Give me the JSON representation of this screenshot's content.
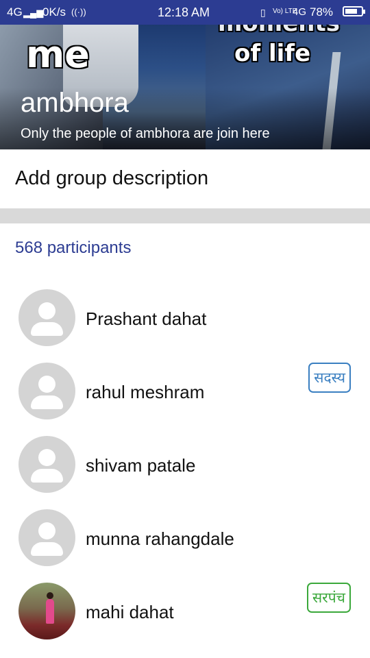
{
  "status_bar": {
    "network_left": "4G",
    "speed": "0K/s",
    "time": "12:18 AM",
    "network_right": "4G",
    "volte": "Vo) LTE",
    "battery": "78%",
    "battery_level": 0.78
  },
  "header": {
    "meme_top_right": "moments",
    "meme_left": "me",
    "meme_right": "of life",
    "group_name": "ambhora",
    "group_tagline": "Only the people of ambhora are join here"
  },
  "description": {
    "placeholder": "Add group description"
  },
  "participants": {
    "count_label": "568 participants",
    "items": [
      {
        "name": "Prashant dahat",
        "badge": "",
        "badge_color": "",
        "avatar": "default"
      },
      {
        "name": "rahul meshram",
        "badge": "सदस्य",
        "badge_color": "#3a7fc1",
        "avatar": "default"
      },
      {
        "name": "shivam patale",
        "badge": "",
        "badge_color": "",
        "avatar": "default"
      },
      {
        "name": "munna rahangdale",
        "badge": "",
        "badge_color": "",
        "avatar": "default"
      },
      {
        "name": "mahi dahat",
        "badge": "सरपंच",
        "badge_color": "#3aa83a",
        "avatar": "photo"
      }
    ]
  },
  "colors": {
    "status_bar": "#2c3c92",
    "accent": "#2c3c92",
    "divider": "#d9d9d9"
  }
}
